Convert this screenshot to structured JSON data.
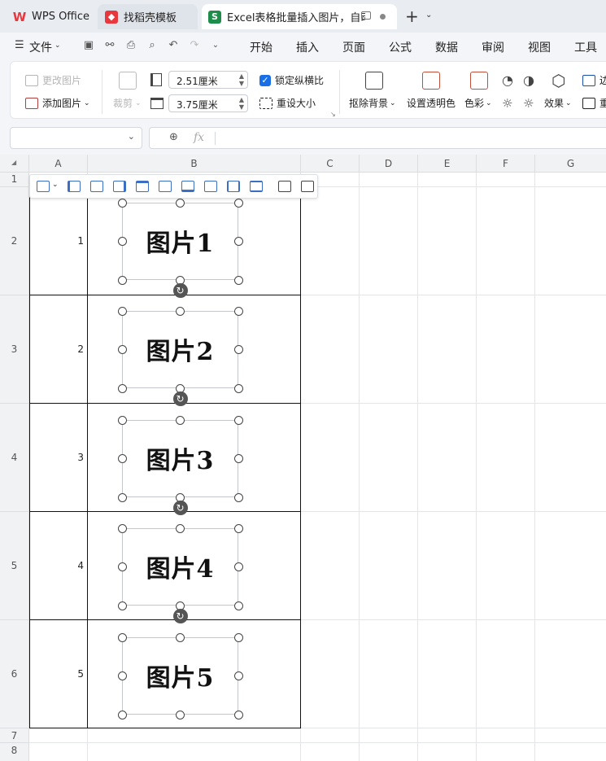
{
  "tabs": [
    {
      "label": "WPS Office"
    },
    {
      "label": "找稻壳模板"
    },
    {
      "label": "Excel表格批量插入图片，自动"
    }
  ],
  "menubar": {
    "file_label": "文件",
    "menus": [
      "开始",
      "插入",
      "页面",
      "公式",
      "数据",
      "审阅",
      "视图",
      "工具"
    ]
  },
  "ribbon": {
    "change_picture": "更改图片",
    "add_picture": "添加图片",
    "crop": "裁剪",
    "height_value": "2.51厘米",
    "width_value": "3.75厘米",
    "lock_aspect": "锁定纵横比",
    "reset_size": "重设大小",
    "remove_bg": "抠除背景",
    "set_transparent": "设置透明色",
    "color": "色彩",
    "effects": "效果",
    "edge_partial": "边",
    "re_partial": "重"
  },
  "formula_bar": {
    "name_box": "",
    "fx_label": "fx",
    "formula": ""
  },
  "sheet": {
    "columns": [
      "A",
      "B",
      "C",
      "D",
      "E",
      "F",
      "G"
    ],
    "rows": [
      "1",
      "2",
      "3",
      "4",
      "5",
      "6",
      "7",
      "8"
    ],
    "a_values": [
      "1",
      "2",
      "3",
      "4",
      "5"
    ],
    "pictures": [
      "图片1",
      "图片2",
      "图片3",
      "图片4",
      "图片5"
    ]
  },
  "colors": {
    "accent": "#1a6ee6",
    "excel_green": "#1e8c4a",
    "wps_red": "#e8383d",
    "daoke_red": "#e8383d"
  }
}
